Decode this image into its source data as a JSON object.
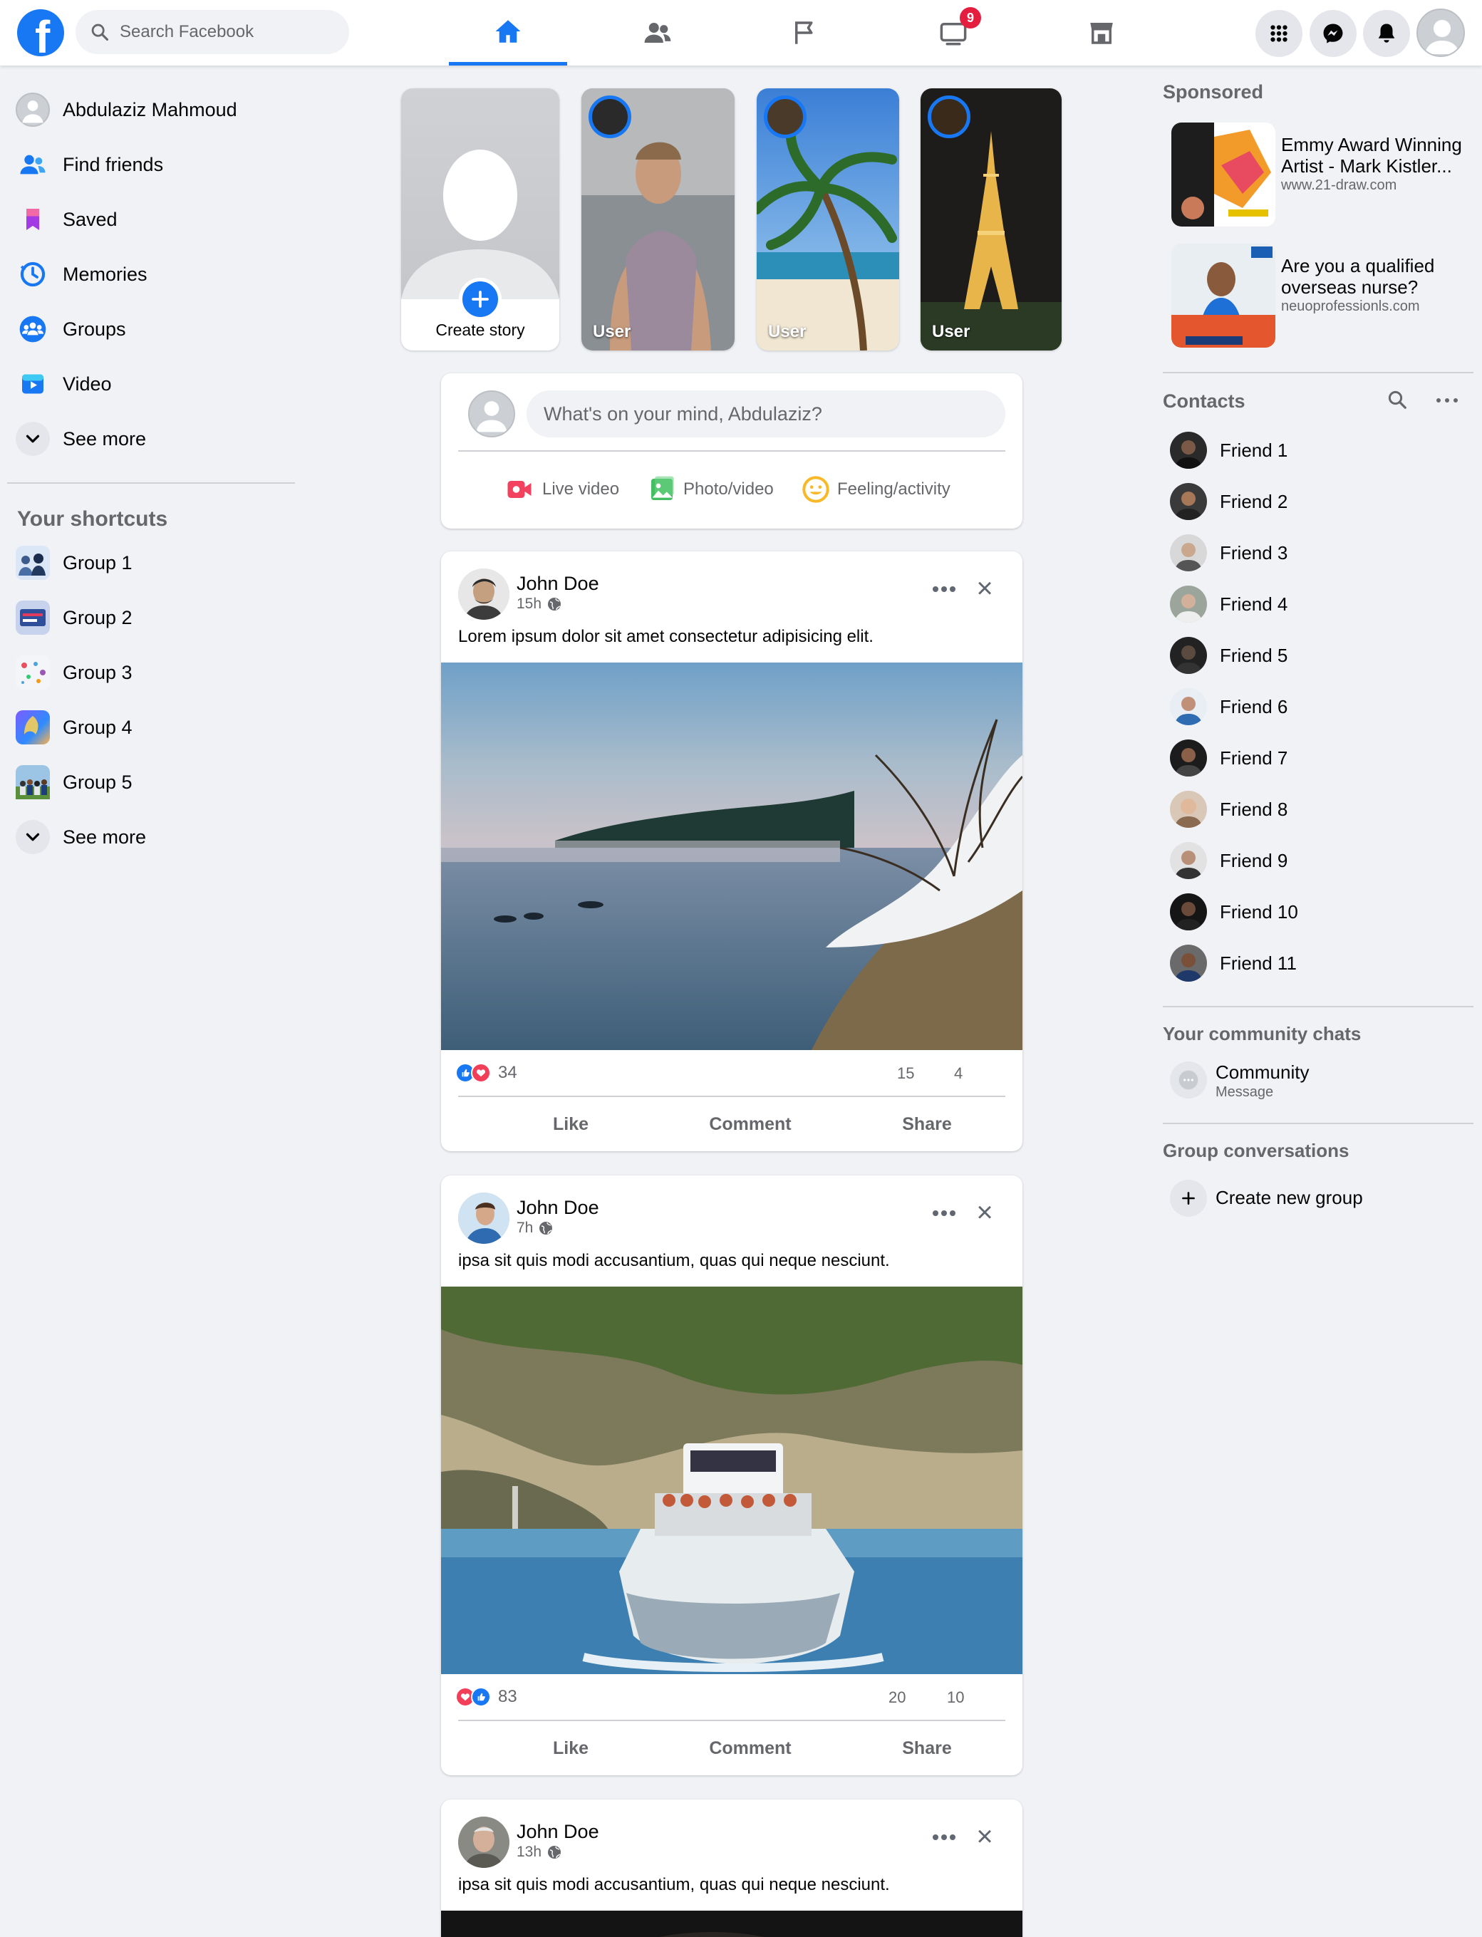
{
  "header": {
    "logo": "f",
    "search_placeholder": "Search Facebook",
    "nav_tabs": [
      {
        "name": "home",
        "icon": "home-icon",
        "active": true
      },
      {
        "name": "friends",
        "icon": "friends-icon",
        "active": false
      },
      {
        "name": "pages",
        "icon": "flag-icon",
        "active": false
      },
      {
        "name": "watch",
        "icon": "watch-icon",
        "badge": "9",
        "active": false
      },
      {
        "name": "marketplace",
        "icon": "marketplace-icon",
        "active": false
      }
    ],
    "right_buttons": [
      "menu-grid-icon",
      "messenger-icon",
      "bell-icon",
      "profile-avatar"
    ]
  },
  "left_sidebar": {
    "items": [
      {
        "label": "Abdulaziz Mahmoud",
        "icon": "profile-avatar"
      },
      {
        "label": "Find friends",
        "icon": "find-friends-icon"
      },
      {
        "label": "Saved",
        "icon": "bookmark-icon"
      },
      {
        "label": "Memories",
        "icon": "clock-icon"
      },
      {
        "label": "Groups",
        "icon": "groups-icon"
      },
      {
        "label": "Video",
        "icon": "video-play-icon"
      },
      {
        "label": "See more",
        "icon": "chevron-down-icon"
      }
    ],
    "shortcuts_title": "Your shortcuts",
    "shortcuts": [
      {
        "label": "Group 1"
      },
      {
        "label": "Group 2"
      },
      {
        "label": "Group 3"
      },
      {
        "label": "Group 4"
      },
      {
        "label": "Group 5"
      },
      {
        "label": "See more"
      }
    ]
  },
  "stories": {
    "create_label": "Create story",
    "items": [
      {
        "label": "User"
      },
      {
        "label": "User"
      },
      {
        "label": "User"
      }
    ]
  },
  "composer": {
    "placeholder": "What's on your mind, Abdulaziz?",
    "options": [
      {
        "label": "Live video",
        "icon": "live-video-icon",
        "color": "#f3425f"
      },
      {
        "label": "Photo/video",
        "icon": "photo-icon",
        "color": "#45bd62"
      },
      {
        "label": "Feeling/activity",
        "icon": "feeling-icon",
        "color": "#f7b928"
      }
    ]
  },
  "posts": [
    {
      "author": "John Doe",
      "time": "15h",
      "text": "Lorem ipsum dolor sit amet consectetur adipisicing elit.",
      "reactions": "34",
      "comments": "15",
      "shares": "4"
    },
    {
      "author": "John Doe",
      "time": "7h",
      "text": "ipsa sit quis modi accusantium, quas qui neque nesciunt.",
      "reactions": "83",
      "comments": "20",
      "shares": "10"
    },
    {
      "author": "John Doe",
      "time": "13h",
      "text": "ipsa sit quis modi accusantium, quas qui neque nesciunt."
    }
  ],
  "post_actions": {
    "like": "Like",
    "comment": "Comment",
    "share": "Share"
  },
  "right_sidebar": {
    "sponsored_title": "Sponsored",
    "sponsored": [
      {
        "title": "Emmy Award Winning Artist - Mark Kistler...",
        "url": "www.21-draw.com"
      },
      {
        "title": "Are you a qualified overseas nurse?",
        "url": "neuoprofessionls.com"
      }
    ],
    "contacts_title": "Contacts",
    "contacts": [
      "Friend 1",
      "Friend 2",
      "Friend 3",
      "Friend 4",
      "Friend 5",
      "Friend 6",
      "Friend 7",
      "Friend 8",
      "Friend 9",
      "Friend 10",
      "Friend 11"
    ],
    "community_title": "Your community chats",
    "community": {
      "name": "Community",
      "sub": "Message"
    },
    "group_conv_title": "Group conversations",
    "create_group": "Create new group"
  },
  "colors": {
    "brand": "#1877f2",
    "background": "#f0f2f5",
    "badge": "#e41e3f"
  }
}
